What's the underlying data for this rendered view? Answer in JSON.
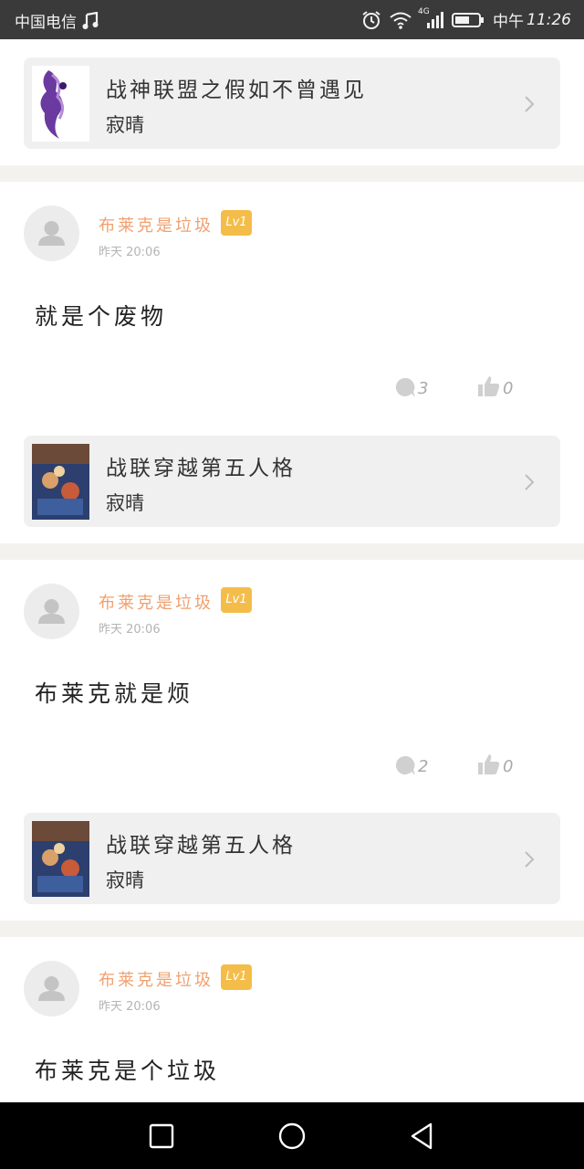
{
  "status_bar": {
    "carrier": "中国电信",
    "network_label": "4G",
    "time_prefix": "中午",
    "time": "11:26"
  },
  "feed": {
    "top_book": {
      "title": "战神联盟之假如不曾遇见",
      "author": "寂晴"
    },
    "posts": [
      {
        "username": "布莱克是垃圾",
        "level": "Lv1",
        "timestamp": "昨天  20:06",
        "text": "就是个废物",
        "comment_count": "3",
        "like_count": "0",
        "book": {
          "title": "战联穿越第五人格",
          "author": "寂晴"
        }
      },
      {
        "username": "布莱克是垃圾",
        "level": "Lv1",
        "timestamp": "昨天  20:06",
        "text": "布莱克就是烦",
        "comment_count": "2",
        "like_count": "0",
        "book": {
          "title": "战联穿越第五人格",
          "author": "寂晴"
        }
      },
      {
        "username": "布莱克是垃圾",
        "level": "Lv1",
        "timestamp": "昨天  20:06",
        "text": "布莱克是个垃圾"
      }
    ]
  },
  "colors": {
    "username": "#f0a070",
    "level_badge": "#f4bd4a",
    "divider": "#f3f2ee",
    "card_bg": "#f0f0f0"
  },
  "icons": {
    "comment": "comment-bubble-icon",
    "like": "thumbs-up-icon",
    "chevron": "chevron-right-icon",
    "nav": [
      "recent-apps-square-icon",
      "home-circle-icon",
      "back-triangle-icon"
    ]
  }
}
